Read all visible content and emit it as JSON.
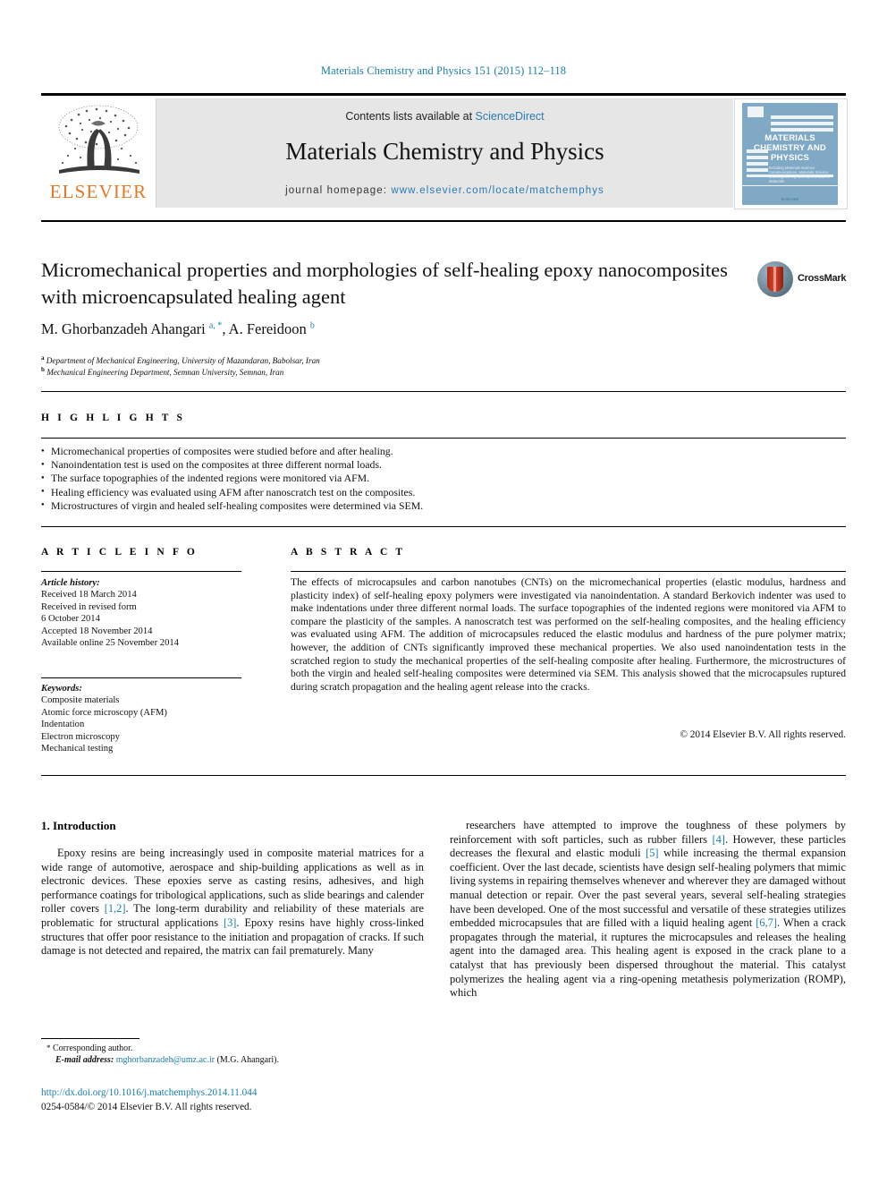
{
  "running_head": "Materials Chemistry and Physics 151 (2015) 112–118",
  "masthead": {
    "publisher_name": "ELSEVIER",
    "contents_prefix": "Contents lists available at ",
    "contents_link": "ScienceDirect",
    "journal_title": "Materials Chemistry and Physics",
    "homepage_label": "journal homepage: ",
    "homepage_url": "www.elsevier.com/locate/matchemphys",
    "cover": {
      "title_line1": "MATERIALS",
      "title_line2": "CHEMISTRY AND",
      "title_line3": "PHYSICS",
      "subtitle": "Including Materials Science Communications, Materials Science and Engineering and Nanostructured Materials",
      "footer": "ELSEVIER"
    }
  },
  "crossmark": {
    "label": "CrossMark",
    "icon": "crossmark-icon"
  },
  "article": {
    "title": "Micromechanical properties and morphologies of self-healing epoxy nanocomposites with microencapsulated healing agent",
    "authors_html": "M. Ghorbanzadeh Ahangari <sup>a, *</sup>, A. Fereidoon <sup>b</sup>",
    "affiliations": [
      {
        "marker": "a",
        "text": "Department of Mechanical Engineering, University of Mazandaran, Babolsar, Iran"
      },
      {
        "marker": "b",
        "text": "Mechanical Engineering Department, Semnan University, Semnan, Iran"
      }
    ]
  },
  "highlights": {
    "heading": "H I G H L I G H T S",
    "items": [
      "Micromechanical properties of composites were studied before and after healing.",
      "Nanoindentation test is used on the composites at three different normal loads.",
      "The surface topographies of the indented regions were monitored via AFM.",
      "Healing efficiency was evaluated using AFM after nanoscratch test on the composites.",
      "Microstructures of virgin and healed self-healing composites were determined via SEM."
    ]
  },
  "article_info": {
    "heading": "A R T I C L E  I N F O",
    "history_label": "Article history:",
    "history": [
      "Received 18 March 2014",
      "Received in revised form",
      "6 October 2014",
      "Accepted 18 November 2014",
      "Available online 25 November 2014"
    ],
    "keywords_label": "Keywords:",
    "keywords": [
      "Composite materials",
      "Atomic force microscopy (AFM)",
      "Indentation",
      "Electron microscopy",
      "Mechanical testing"
    ]
  },
  "abstract": {
    "heading": "A B S T R A C T",
    "text": "The effects of microcapsules and carbon nanotubes (CNTs) on the micromechanical properties (elastic modulus, hardness and plasticity index) of self-healing epoxy polymers were investigated via nanoindentation. A standard Berkovich indenter was used to make indentations under three different normal loads. The surface topographies of the indented regions were monitored via AFM to compare the plasticity of the samples. A nanoscratch test was performed on the self-healing composites, and the healing efficiency was evaluated using AFM. The addition of microcapsules reduced the elastic modulus and hardness of the pure polymer matrix; however, the addition of CNTs significantly improved these mechanical properties. We also used nanoindentation tests in the scratched region to study the mechanical properties of the self-healing composite after healing. Furthermore, the microstructures of both the virgin and healed self-healing composites were determined via SEM. This analysis showed that the microcapsules ruptured during scratch propagation and the healing agent release into the cracks.",
    "copyright": "© 2014 Elsevier B.V. All rights reserved."
  },
  "body": {
    "section_number_title": "1.  Introduction",
    "left_column_html": "Epoxy resins are being increasingly used in composite material matrices for a wide range of automotive, aerospace and ship-building applications as well as in electronic devices. These epoxies serve as casting resins, adhesives, and high performance coatings for tribological applications, such as slide bearings and calender roller covers <span class=\"ref\">[1,2]</span>. The long-term durability and reliability of these materials are problematic for structural applications <span class=\"ref\">[3]</span>. Epoxy resins have highly cross-linked structures that offer poor resistance to the initiation and propagation of cracks. If such damage is not detected and repaired, the matrix can fail prematurely. Many",
    "right_column_html": "researchers have attempted to improve the toughness of these polymers by reinforcement with soft particles, such as rubber fillers <span class=\"ref\">[4]</span>. However, these particles decreases the flexural and elastic moduli <span class=\"ref\">[5]</span> while increasing the thermal expansion coefficient. Over the last decade, scientists have design self-healing polymers that mimic living systems in repairing themselves whenever and wherever they are damaged without manual detection or repair. Over the past several years, several self-healing strategies have been developed. One of the most successful and versatile of these strategies utilizes embedded microcapsules that are filled with a liquid healing agent <span class=\"ref\">[6,7]</span>. When a crack propagates through the material, it ruptures the microcapsules and releases the healing agent into the damaged area. This healing agent is exposed in the crack plane to a catalyst that has previously been dispersed throughout the material. This catalyst polymerizes the healing agent via a ring-opening metathesis polymerization (ROMP), which"
  },
  "footer": {
    "corresponding_html": "<span class=\"star\">*</span> Corresponding author.",
    "email_label": "E-mail address:",
    "email": "mghorbanzadeh@umz.ac.ir",
    "email_suffix": " (M.G. Ahangari).",
    "doi": "http://dx.doi.org/10.1016/j.matchemphys.2014.11.044",
    "issn": "0254-0584/© 2014 Elsevier B.V. All rights reserved."
  },
  "colors": {
    "link": "#1a7fa8",
    "elsevier_orange": "#E87722",
    "banner_gray": "#e6e6e6",
    "cover_blue": "#7fa9c4"
  }
}
